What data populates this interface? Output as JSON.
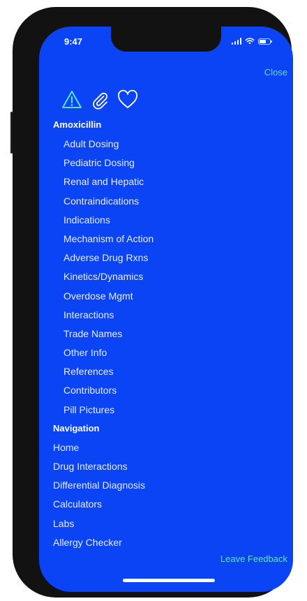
{
  "status_bar": {
    "time": "9:47"
  },
  "header": {
    "close_label": "Close"
  },
  "action_icons": [
    {
      "name": "warning-icon"
    },
    {
      "name": "paperclip-icon"
    },
    {
      "name": "heart-icon"
    }
  ],
  "colors": {
    "background": "#0b44f5",
    "accent": "#5fe0c8",
    "text": "#ffffff"
  },
  "drug_section": {
    "title": "Amoxicillin",
    "items": [
      "Adult Dosing",
      "Pediatric Dosing",
      "Renal and Hepatic",
      "Contraindications",
      "Indications",
      "Mechanism of Action",
      "Adverse Drug Rxns",
      "Kinetics/Dynamics",
      "Overdose Mgmt",
      "Interactions",
      "Trade Names",
      "Other Info",
      "References",
      "Contributors",
      "Pill Pictures"
    ]
  },
  "navigation_section": {
    "title": "Navigation",
    "items": [
      "Home",
      "Drug Interactions",
      "Differential Diagnosis",
      "Calculators",
      "Labs",
      "Allergy Checker"
    ]
  },
  "footer": {
    "feedback_label": "Leave Feedback"
  }
}
